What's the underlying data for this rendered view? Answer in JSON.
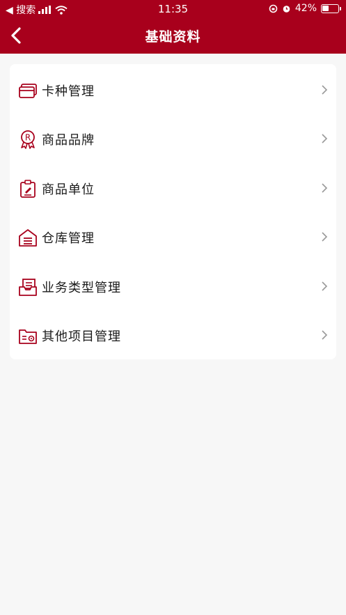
{
  "status_bar": {
    "back_app": "◀ 搜索",
    "time": "11:35",
    "battery_percent": "42%",
    "battery_level": 0.42
  },
  "nav": {
    "title": "基础资料",
    "back_icon": "chevron-left-icon"
  },
  "menu": {
    "items": [
      {
        "label": "卡种管理",
        "icon": "card-icon"
      },
      {
        "label": "商品品牌",
        "icon": "brand-badge-icon"
      },
      {
        "label": "商品单位",
        "icon": "unit-clipboard-icon"
      },
      {
        "label": "仓库管理",
        "icon": "warehouse-icon"
      },
      {
        "label": "业务类型管理",
        "icon": "business-type-icon"
      },
      {
        "label": "其他项目管理",
        "icon": "folder-settings-icon"
      }
    ]
  },
  "colors": {
    "brand": "#a8001c",
    "background": "#f7f7f7",
    "card": "#ffffff",
    "text": "#1a1a1a",
    "chevron": "#999999"
  }
}
